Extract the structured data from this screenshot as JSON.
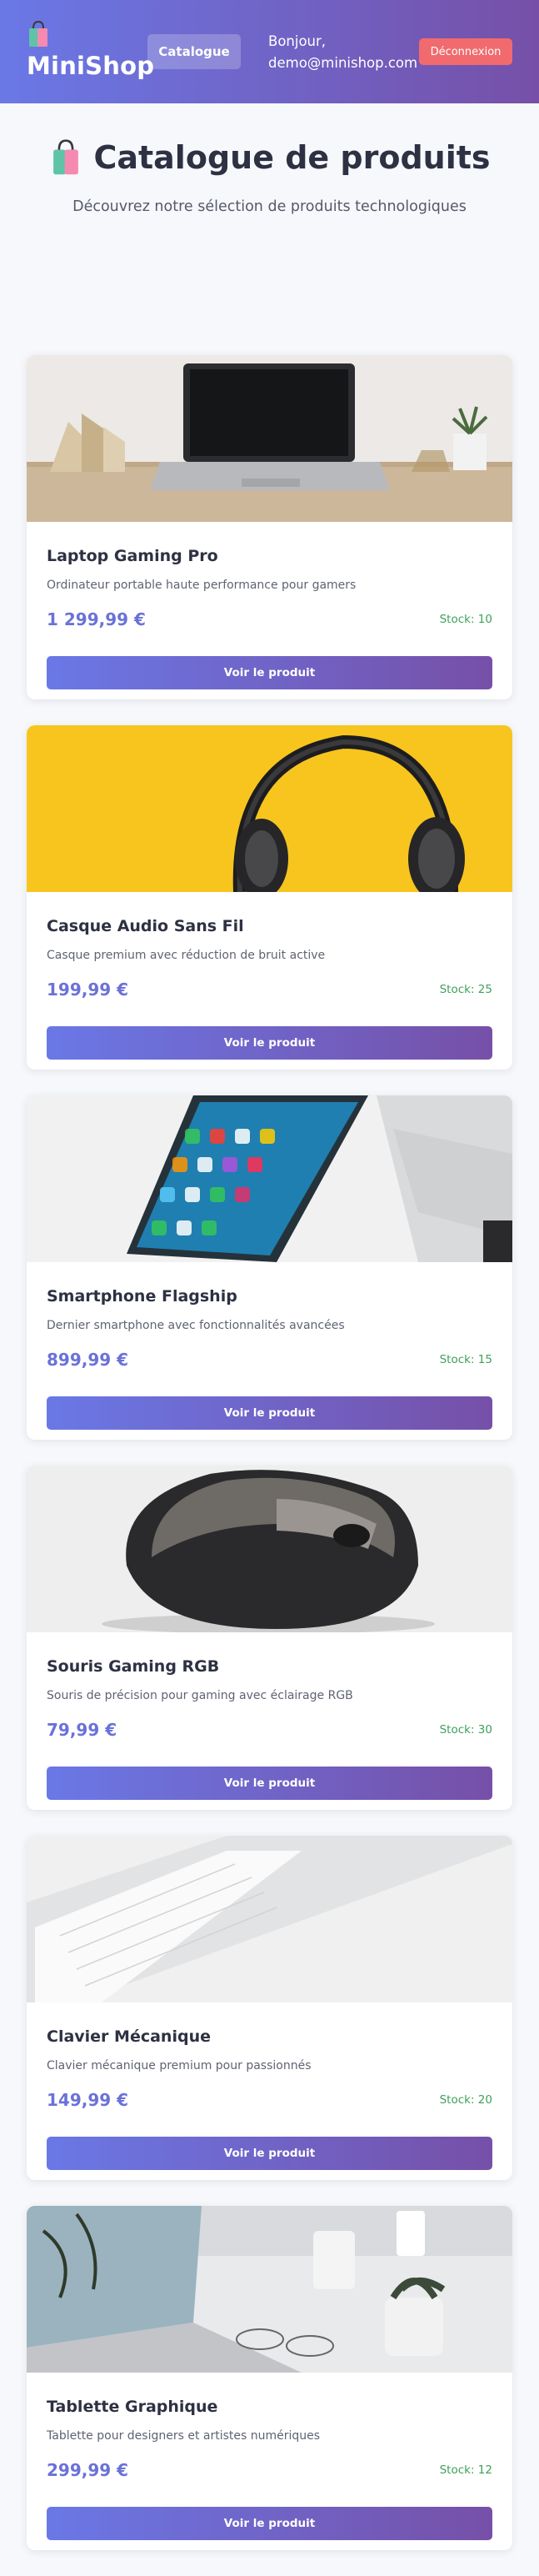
{
  "header": {
    "brand": "MiniShop",
    "nav_catalogue": "Catalogue",
    "greeting_line1": "Bonjour,",
    "greeting_line2": "demo@minishop.com",
    "logout": "Déconnexion"
  },
  "hero": {
    "title": "Catalogue de produits",
    "subtitle": "Découvrez notre sélection de produits technologiques"
  },
  "products": [
    {
      "name": "Laptop Gaming Pro",
      "description": "Ordinateur portable haute performance pour gamers",
      "price": "1 299,99 €",
      "stock": "Stock: 10",
      "button": "Voir le produit",
      "image": "laptop-image"
    },
    {
      "name": "Casque Audio Sans Fil",
      "description": "Casque premium avec réduction de bruit active",
      "price": "199,99 €",
      "stock": "Stock: 25",
      "button": "Voir le produit",
      "image": "headphones-image"
    },
    {
      "name": "Smartphone Flagship",
      "description": "Dernier smartphone avec fonctionnalités avancées",
      "price": "899,99 €",
      "stock": "Stock: 15",
      "button": "Voir le produit",
      "image": "smartphone-image"
    },
    {
      "name": "Souris Gaming RGB",
      "description": "Souris de précision pour gaming avec éclairage RGB",
      "price": "79,99 €",
      "stock": "Stock: 30",
      "button": "Voir le produit",
      "image": "mouse-image"
    },
    {
      "name": "Clavier Mécanique",
      "description": "Clavier mécanique premium pour passionnés",
      "price": "149,99 €",
      "stock": "Stock: 20",
      "button": "Voir le produit",
      "image": "keyboard-image"
    },
    {
      "name": "Tablette Graphique",
      "description": "Tablette pour designers et artistes numériques",
      "price": "299,99 €",
      "stock": "Stock: 12",
      "button": "Voir le produit",
      "image": "desk-laptop-image"
    }
  ],
  "colors": {
    "gradient_start": "#6a78e6",
    "gradient_end": "#7650a8",
    "price": "#6a72d8",
    "stock": "#3fa05a",
    "logout": "#f16a6e"
  }
}
